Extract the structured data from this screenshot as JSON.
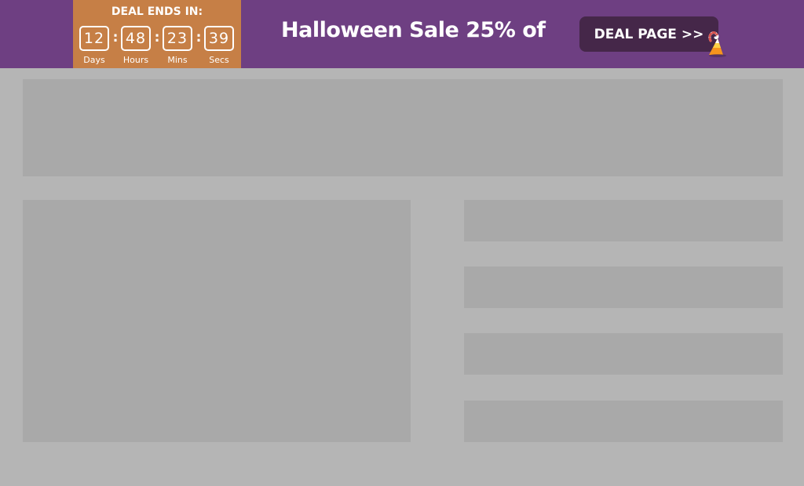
{
  "banner": {
    "countdown": {
      "title": "DEAL ENDS IN:",
      "units": [
        {
          "value": "12",
          "label": "Days"
        },
        {
          "value": "48",
          "label": "Hours"
        },
        {
          "value": "23",
          "label": "Mins"
        },
        {
          "value": "39",
          "label": "Secs"
        }
      ],
      "separator": ":"
    },
    "headline": "Halloween Sale 25% of",
    "button_label": "DEAL PAGE >>",
    "icon": "candy-corn-icon",
    "colors": {
      "banner_bg": "#6e3f82",
      "countdown_bg": "#c67f46",
      "button_bg": "#452749",
      "page_bg": "#b5b5b5",
      "placeholder": "#a9a9a9"
    }
  }
}
